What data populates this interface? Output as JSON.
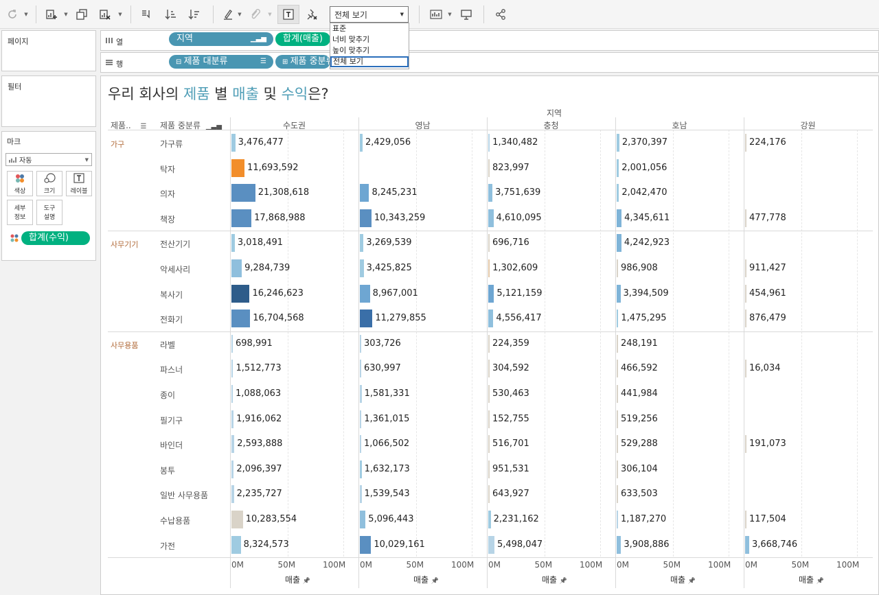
{
  "toolbar": {
    "fit_value": "전체 보기",
    "fit_options": [
      "표준",
      "너비 맞추기",
      "높이 맞추기",
      "전체 보기"
    ]
  },
  "shelves": {
    "pages_label": "페이지",
    "filters_label": "필터",
    "marks_label": "마크",
    "columns_label": "열",
    "rows_label": "행",
    "column_pills": [
      "지역",
      "합계(매출)"
    ],
    "row_pills": [
      "제품 대분류",
      "제품 중분류"
    ]
  },
  "marks": {
    "type_value": "자동",
    "buttons": [
      "색상",
      "크기",
      "레이블",
      "세부\n정보",
      "도구\n설명"
    ],
    "color_pill": "합계(수익)"
  },
  "view": {
    "title_parts": [
      {
        "text": "우리 회사의 ",
        "color": "#333333"
      },
      {
        "text": "제품",
        "color": "#4e9db6"
      },
      {
        "text": " 별 ",
        "color": "#333333"
      },
      {
        "text": "매출",
        "color": "#4e9db6"
      },
      {
        "text": " 및 ",
        "color": "#333333"
      },
      {
        "text": "수익",
        "color": "#4e9db6"
      },
      {
        "text": "은?",
        "color": "#333333"
      }
    ],
    "top_header": "지역",
    "row_header_1": "제품..",
    "row_header_2": "제품 중분류",
    "axis_ticks": [
      "0M",
      "50M",
      "100M"
    ],
    "axis_title": "매출"
  },
  "chart_data": {
    "type": "bar",
    "orientation": "horizontal",
    "measure": "매출",
    "color_measure": "합계(수익)",
    "xlim": [
      0,
      100000000
    ],
    "regions": [
      "수도권",
      "영남",
      "충청",
      "호남",
      "강원"
    ],
    "groups": [
      {
        "category": "가구",
        "rows": [
          {
            "sub": "가구류",
            "values": [
              3476477,
              2429056,
              1340482,
              2370397,
              224176
            ],
            "colors": [
              "#9fcbe1",
              "#9fcbe1",
              "#b7d4e6",
              "#9fcbe1",
              "#d9d3c8"
            ]
          },
          {
            "sub": "탁자",
            "values": [
              11693592,
              null,
              823997,
              2001056,
              null
            ],
            "colors": [
              "#f28e2b",
              null,
              "#d9d3c8",
              "#9fcbe1",
              null
            ]
          },
          {
            "sub": "의자",
            "values": [
              21308618,
              8245231,
              3751639,
              2042470,
              null
            ],
            "colors": [
              "#5a8fc1",
              "#6ea6d2",
              "#8fbfdd",
              "#9fcbe1",
              null
            ]
          },
          {
            "sub": "책장",
            "values": [
              17868988,
              10343259,
              4610095,
              4345611,
              477778
            ],
            "colors": [
              "#5a8fc1",
              "#5a8fc1",
              "#8fbfdd",
              "#7fb4d8",
              "#d9d3c8"
            ]
          }
        ]
      },
      {
        "category": "사무기기",
        "rows": [
          {
            "sub": "전산기기",
            "values": [
              3018491,
              3269539,
              696716,
              4242923,
              null
            ],
            "colors": [
              "#9fcbe1",
              "#9fcbe1",
              "#d9d3c8",
              "#7fb4d8",
              null
            ]
          },
          {
            "sub": "악세사리",
            "values": [
              9284739,
              3425825,
              1302609,
              986908,
              911427
            ],
            "colors": [
              "#8fbfdd",
              "#9fcbe1",
              "#e2c7a8",
              "#d9d3c8",
              "#d9d3c8"
            ]
          },
          {
            "sub": "복사기",
            "values": [
              16246623,
              8967001,
              5121159,
              3394509,
              454961
            ],
            "colors": [
              "#2e5c8a",
              "#6ea6d2",
              "#6ea6d2",
              "#7fb4d8",
              "#d9d3c8"
            ]
          },
          {
            "sub": "전화기",
            "values": [
              16704568,
              11279855,
              4556417,
              1475295,
              876479
            ],
            "colors": [
              "#5a8fc1",
              "#3a6fa8",
              "#8fbfdd",
              "#9fcbe1",
              "#d9d3c8"
            ]
          }
        ]
      },
      {
        "category": "사무용품",
        "rows": [
          {
            "sub": "라벨",
            "values": [
              698991,
              303726,
              224359,
              248191,
              null
            ],
            "colors": [
              "#b7d4e6",
              "#b7d4e6",
              "#d9d3c8",
              "#d9d3c8",
              null
            ]
          },
          {
            "sub": "파스너",
            "values": [
              1512773,
              630997,
              304592,
              466592,
              16034
            ],
            "colors": [
              "#b7d4e6",
              "#b7d4e6",
              "#d9d3c8",
              "#d9d3c8",
              "#d9d3c8"
            ]
          },
          {
            "sub": "종이",
            "values": [
              1088063,
              1581331,
              530463,
              441984,
              null
            ],
            "colors": [
              "#b7d4e6",
              "#b7d4e6",
              "#d9d3c8",
              "#d9d3c8",
              null
            ]
          },
          {
            "sub": "필기구",
            "values": [
              1916062,
              1361015,
              152755,
              519256,
              null
            ],
            "colors": [
              "#b7d4e6",
              "#b7d4e6",
              "#d9d3c8",
              "#d9d3c8",
              null
            ]
          },
          {
            "sub": "바인더",
            "values": [
              2593888,
              1066502,
              516701,
              529288,
              191073
            ],
            "colors": [
              "#b7d4e6",
              "#b7d4e6",
              "#d9d3c8",
              "#d9d3c8",
              "#d9d3c8"
            ]
          },
          {
            "sub": "봉투",
            "values": [
              2096397,
              1632173,
              951531,
              306104,
              null
            ],
            "colors": [
              "#b7d4e6",
              "#9fcbe1",
              "#d9d3c8",
              "#d9d3c8",
              null
            ]
          },
          {
            "sub": "일반 사무용품",
            "values": [
              2235727,
              1539543,
              643927,
              633503,
              null
            ],
            "colors": [
              "#b7d4e6",
              "#b7d4e6",
              "#d9d3c8",
              "#d9d3c8",
              null
            ]
          },
          {
            "sub": "수납용품",
            "values": [
              10283554,
              5096443,
              2231162,
              1187270,
              117504
            ],
            "colors": [
              "#d9d3c8",
              "#8fbfdd",
              "#9fcbe1",
              "#b7d4e6",
              "#d9d3c8"
            ]
          },
          {
            "sub": "가전",
            "values": [
              8324573,
              10029161,
              5498047,
              3908886,
              3668746
            ],
            "colors": [
              "#9fcbe1",
              "#5a8fc1",
              "#b7d4e6",
              "#8fbfdd",
              "#8fbfdd"
            ]
          }
        ]
      }
    ]
  }
}
